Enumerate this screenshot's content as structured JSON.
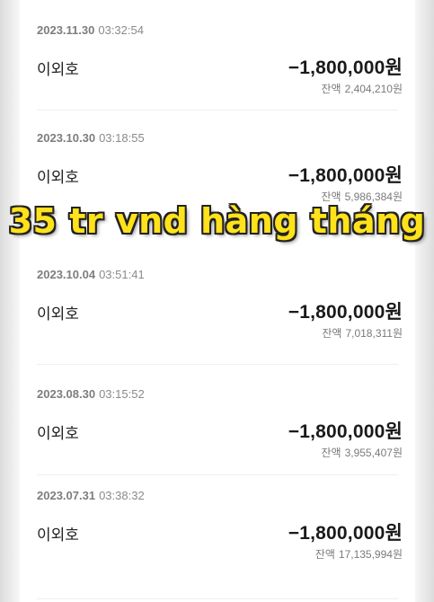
{
  "currency_suffix": "원",
  "balance_label": "잔액",
  "transactions": [
    {
      "date": "2023.11.30",
      "time": "03:32:54",
      "counterparty": "이외호",
      "amount": "−1,800,000원",
      "balance": "2,404,210원"
    },
    {
      "date": "2023.10.30",
      "time": "03:18:55",
      "counterparty": "이외호",
      "amount": "−1,800,000원",
      "balance": "5,986,384원"
    },
    {
      "date": "2023.10.04",
      "time": "03:51:41",
      "counterparty": "이외호",
      "amount": "−1,800,000원",
      "balance": "7,018,311원"
    },
    {
      "date": "2023.08.30",
      "time": "03:15:52",
      "counterparty": "이외호",
      "amount": "−1,800,000원",
      "balance": "3,955,407원"
    },
    {
      "date": "2023.07.31",
      "time": "03:38:32",
      "counterparty": "이외호",
      "amount": "−1,800,000원",
      "balance": "17,135,994원"
    }
  ],
  "overlay": {
    "caption": "35 tr vnd hàng tháng",
    "color": "#ffe21a"
  }
}
